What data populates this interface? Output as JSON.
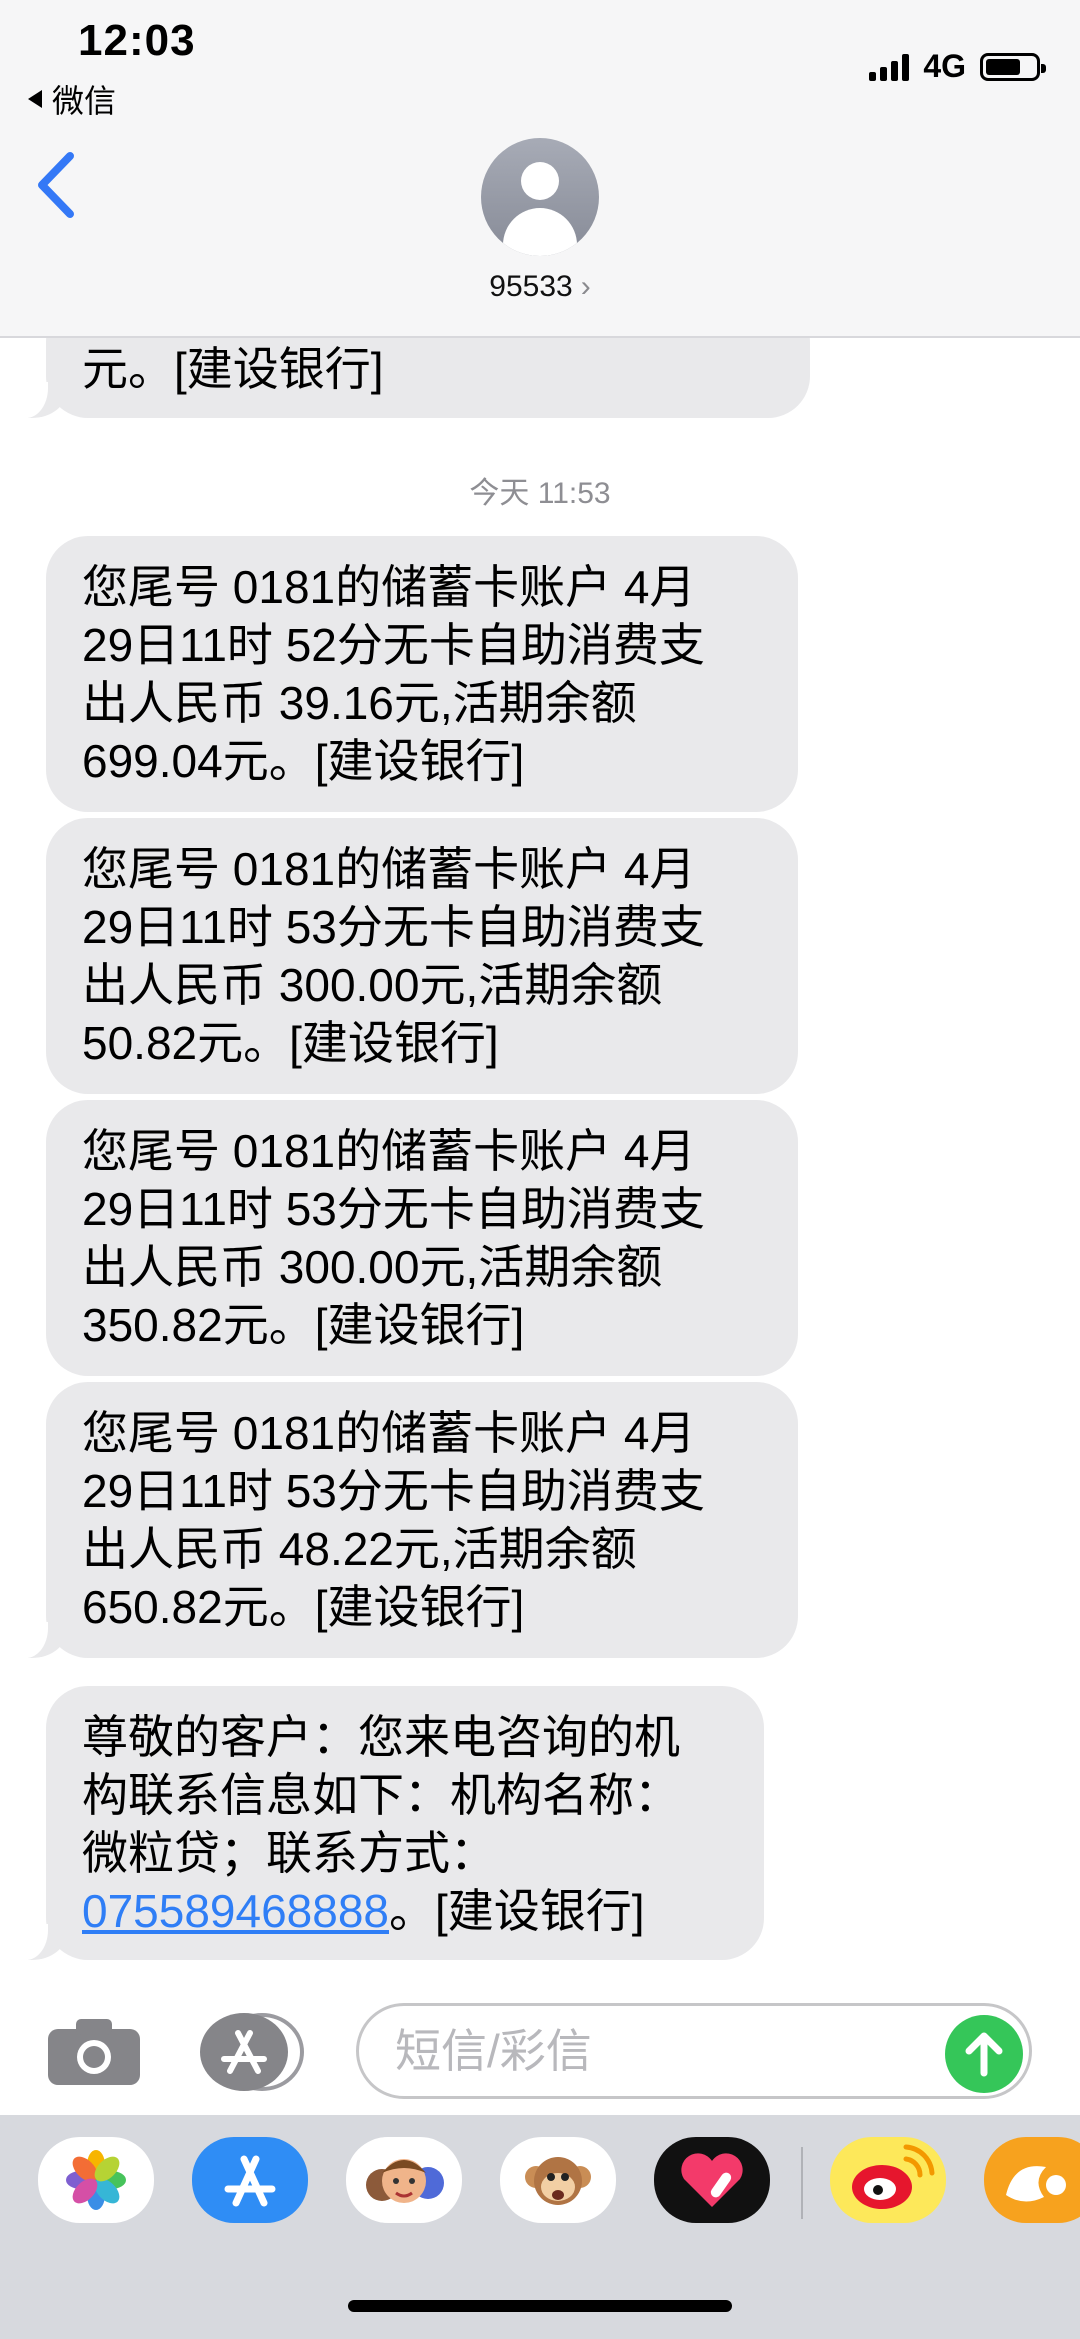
{
  "status_bar": {
    "time": "12:03",
    "back_app": "微信",
    "network": "4G",
    "battery_level": 0.7
  },
  "header": {
    "contact": "95533",
    "chevron": "›"
  },
  "thread": {
    "partial_message": "元。[建设银行]",
    "timestamp": "今天 11:53",
    "messages": [
      {
        "text": "您尾号 0181的储蓄卡账户 4月\n29日11时 52分无卡自助消费支\n出人民币 39.16元,活期余额\n699.04元。[建设银行]"
      },
      {
        "text": "您尾号 0181的储蓄卡账户 4月\n29日11时 53分无卡自助消费支\n出人民币 300.00元,活期余额\n50.82元。[建设银行]"
      },
      {
        "text": "您尾号 0181的储蓄卡账户 4月\n29日11时 53分无卡自助消费支\n出人民币 300.00元,活期余额\n350.82元。[建设银行]"
      },
      {
        "text": "您尾号 0181的储蓄卡账户 4月\n29日11时 53分无卡自助消费支\n出人民币 48.22元,活期余额\n650.82元。[建设银行]"
      }
    ],
    "last_message": {
      "text": "尊敬的客户：您来电咨询的机\n构联系信息如下：机构名称：\n微粒贷；联系方式：",
      "phone_link": "075589468888",
      "suffix": "。[建设银行]"
    }
  },
  "input": {
    "placeholder": "短信/彩信"
  },
  "drawer": {
    "apps": [
      "photos-icon",
      "app-store-icon",
      "memoji-icon",
      "animoji-icon",
      "digital-touch-icon",
      "weibo-icon",
      "uc-browser-icon"
    ]
  },
  "colors": {
    "bubble": "#e9e9eb",
    "link": "#2f7ef6",
    "send": "#35c659",
    "ios_blue": "#3478f6"
  }
}
